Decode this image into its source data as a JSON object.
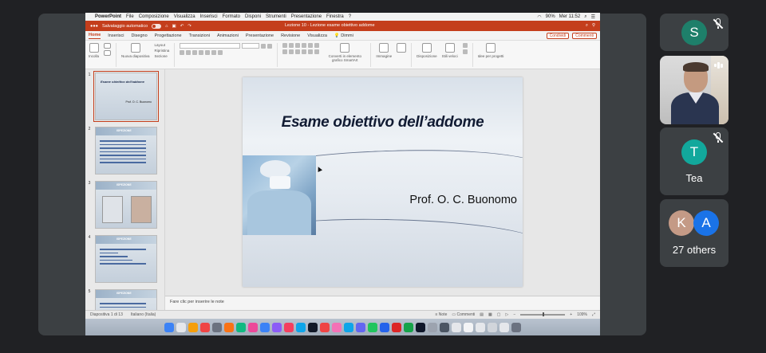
{
  "mac_menu": {
    "app": "PowerPoint",
    "items": [
      "File",
      "Composizione",
      "Visualizza",
      "Inserisci",
      "Formato",
      "Disponi",
      "Strumenti",
      "Presentazione",
      "Finestra",
      "?"
    ],
    "battery": "90%",
    "clock": "Mer 11:52"
  },
  "titlebar": {
    "autosave_label": "Salvataggio automatico",
    "document_title": "Lezione 10 - Lezione esame obiettivo addome"
  },
  "ribbon_tabs": [
    "Home",
    "Inserisci",
    "Disegno",
    "Progettazione",
    "Transizioni",
    "Animazioni",
    "Presentazione",
    "Revisione",
    "Visualizza",
    "Dimmi"
  ],
  "ribbon_share": {
    "share_label": "Condividi",
    "comments_label": "Commenti"
  },
  "ribbon": {
    "paste": "Incolla",
    "new_slide": "Nuova diapositiva",
    "layout": "Layout",
    "reset": "Ripristina",
    "section": "Sezione",
    "smartart": "Converti in elemento grafico SmartArt",
    "picture": "Immagine",
    "arrange": "Disposizione",
    "styles": "Stili veloci",
    "designer": "Idee per progetti"
  },
  "slides": [
    {
      "num": "1",
      "title": "Esame obiettivo dell'addome",
      "author": "Prof. O. C. Buonomo"
    },
    {
      "num": "2",
      "head": "ISPEZIONE"
    },
    {
      "num": "3",
      "head": "ISPEZIONE"
    },
    {
      "num": "4",
      "head": "ISPEZIONE"
    },
    {
      "num": "5",
      "head": "ISPEZIONE"
    }
  ],
  "current_slide": {
    "title": "Esame obiettivo dell’addome",
    "author": "Prof. O. C. Buonomo"
  },
  "notes_placeholder": "Fare clic per inserire le note",
  "statusbar": {
    "slide_counter": "Diapositiva 1 di 13",
    "language": "Italiano (Italia)",
    "notes": "Note",
    "comments": "Commenti",
    "zoom": "109%"
  },
  "participants": [
    {
      "initial": "S",
      "color": "#1e7f6a",
      "muted": true
    },
    {
      "name": "Tea",
      "initial": "T",
      "color": "#12a89c",
      "muted": true
    },
    {
      "others_label": "27 others",
      "initial_a": "K",
      "color_a": "#c49a86",
      "initial_b": "A",
      "color_b": "#1a73e8"
    }
  ],
  "dock_colors": [
    "#3b82f6",
    "#e5e7eb",
    "#f59e0b",
    "#ef4444",
    "#6b7280",
    "#f97316",
    "#10b981",
    "#ec4899",
    "#3b82f6",
    "#8b5cf6",
    "#f43f5e",
    "#0ea5e9",
    "#111827",
    "#ef4444",
    "#f472b6",
    "#0ea5e9",
    "#6366f1",
    "#22c55e",
    "#2563eb",
    "#dc2626",
    "#16a34a",
    "#0f172a",
    "#9ca3af",
    "#4b5563",
    "#e5e7eb",
    "#f3f4f6",
    "#e5e7eb",
    "#d1d5db",
    "#e5e7eb",
    "#6b7280"
  ]
}
